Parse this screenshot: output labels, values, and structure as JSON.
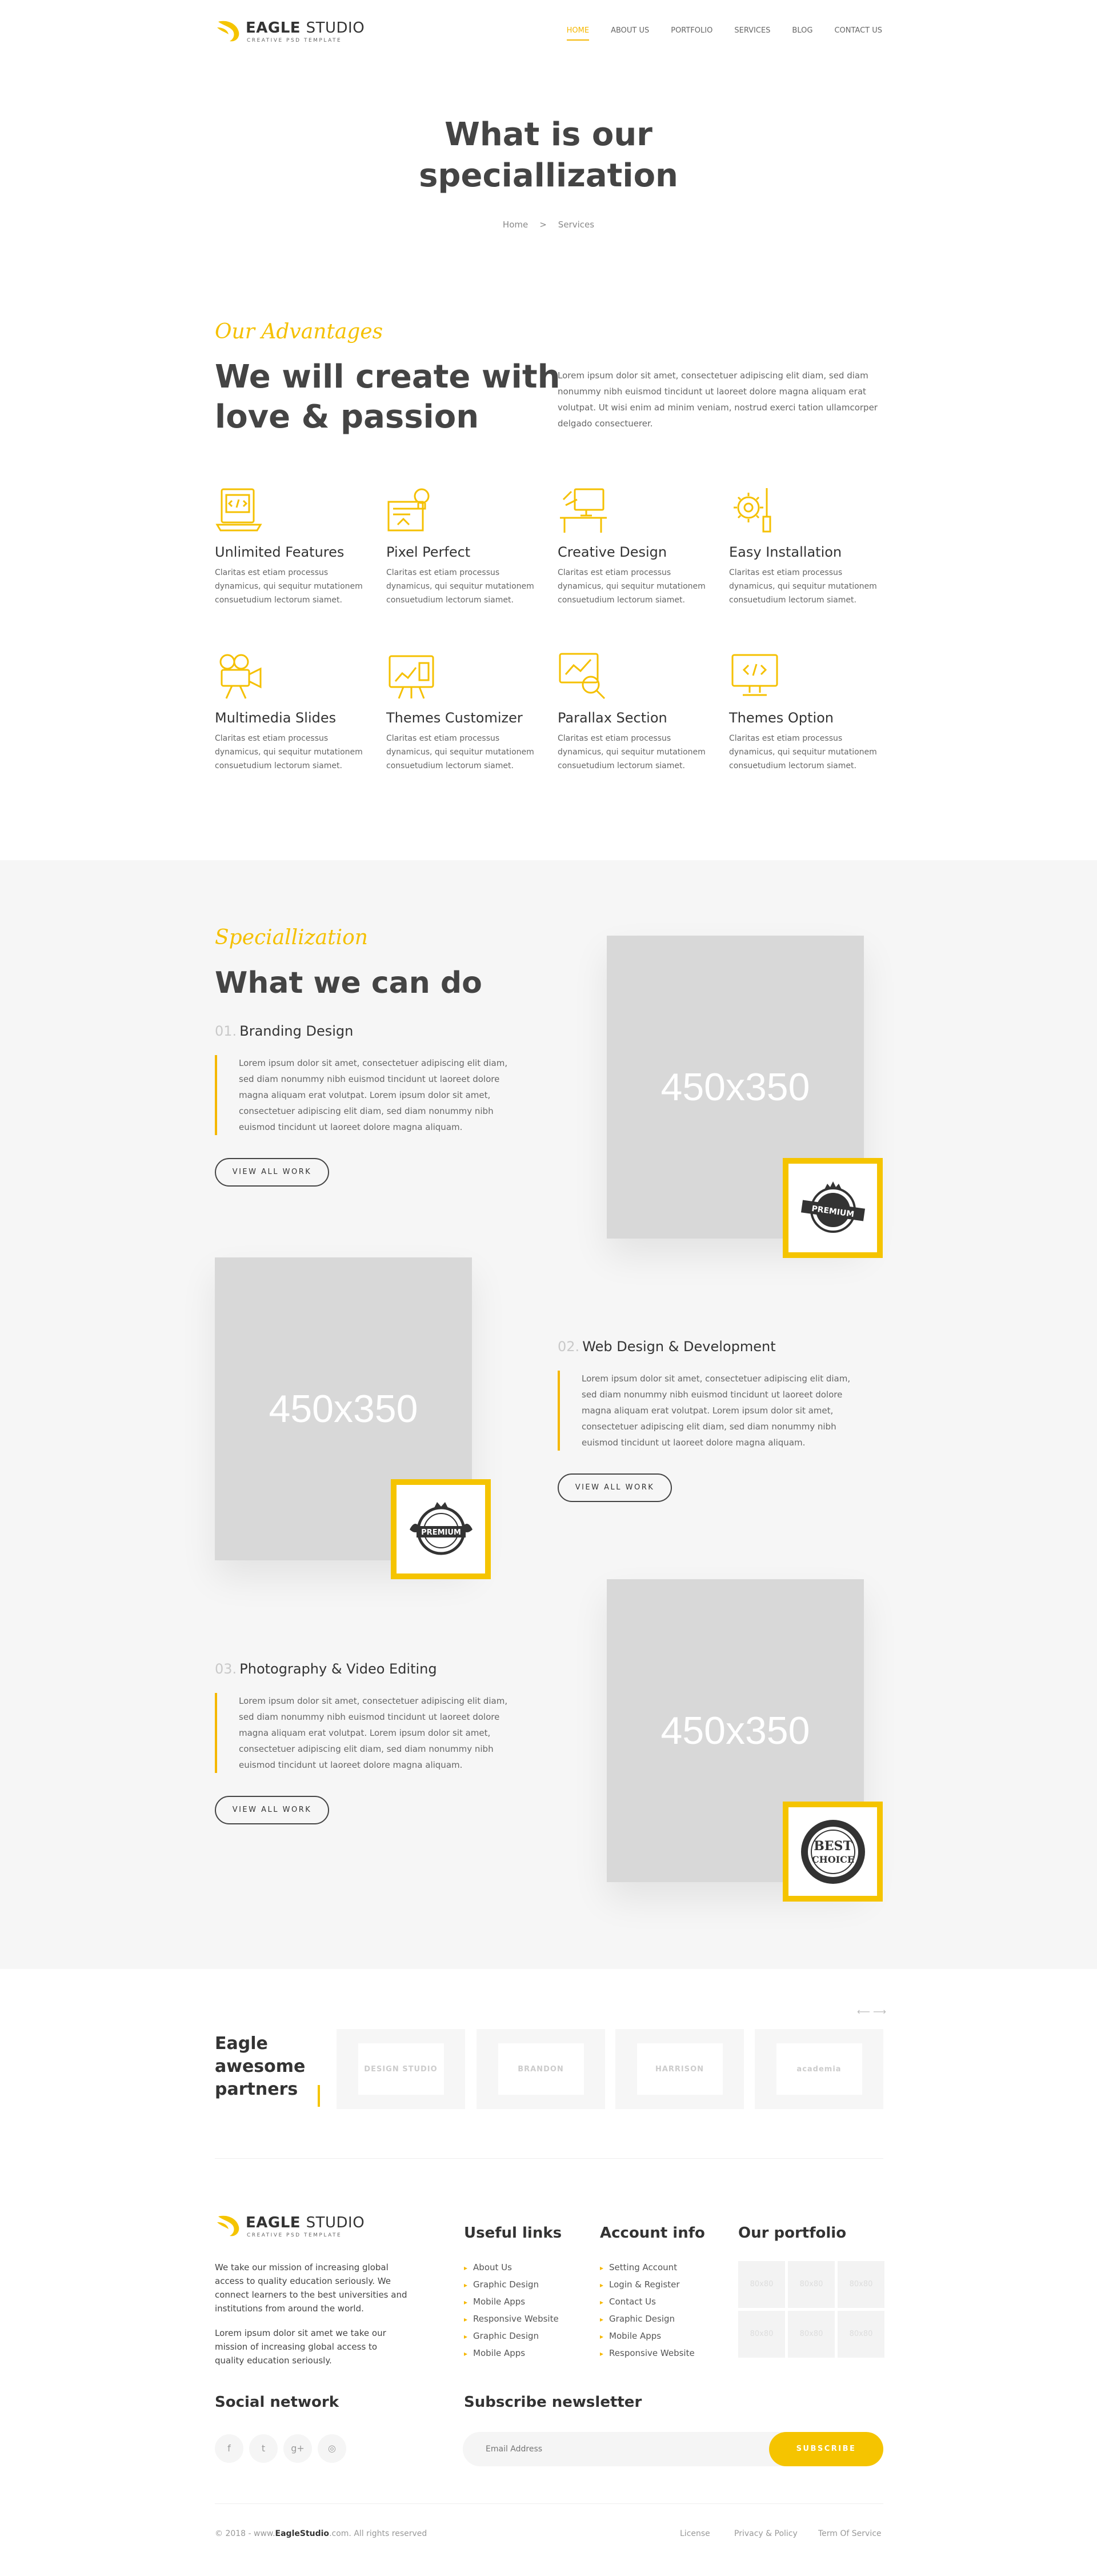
{
  "brand": {
    "name_bold": "EAGLE",
    "name_light": "STUDIO",
    "tagline": "CREATIVE PSD TEMPLATE"
  },
  "nav": [
    {
      "label": "HOME",
      "active": true
    },
    {
      "label": "ABOUT US",
      "active": false
    },
    {
      "label": "PORTFOLIO",
      "active": false
    },
    {
      "label": "SERVICES",
      "active": false
    },
    {
      "label": "BLOG",
      "active": false
    },
    {
      "label": "CONTACT US",
      "active": false
    }
  ],
  "hero": {
    "title_line1": "What is our",
    "title_line2": "speciallization",
    "breadcrumb": [
      "Home",
      ">",
      "Services"
    ]
  },
  "advantages": {
    "script": "Our Advantages",
    "title_line1": "We will create with",
    "title_line2": "love & passion",
    "intro": "Lorem ipsum dolor sit amet, consectetuer adipiscing elit diam, sed diam nonummy nibh euismod tincidunt ut laoreet dolore magna aliquam erat volutpat. Ut wisi enim ad minim veniam, nostrud exerci tation ullamcorper delgado consectuerer.",
    "features": [
      {
        "icon": "laptop-code-icon",
        "title": "Unlimited Features",
        "text": "Claritas est etiam processus dynamicus, qui sequitur mutationem consuetudium lectorum siamet."
      },
      {
        "icon": "design-tools-icon",
        "title": "Pixel Perfect",
        "text": "Claritas est etiam processus dynamicus, qui sequitur mutationem consuetudium lectorum siamet."
      },
      {
        "icon": "workspace-desk-icon",
        "title": "Creative Design",
        "text": "Claritas est etiam processus dynamicus, qui sequitur mutationem consuetudium lectorum siamet."
      },
      {
        "icon": "gear-wrench-icon",
        "title": "Easy Installation",
        "text": "Claritas est etiam processus dynamicus, qui sequitur mutationem consuetudium lectorum siamet."
      },
      {
        "icon": "video-camera-icon",
        "title": "Multimedia Slides",
        "text": "Claritas est etiam processus dynamicus, qui sequitur mutationem consuetudium lectorum siamet."
      },
      {
        "icon": "dashboard-board-icon",
        "title": "Themes Customizer",
        "text": "Claritas est etiam processus dynamicus, qui sequitur mutationem consuetudium lectorum siamet."
      },
      {
        "icon": "analytics-search-icon",
        "title": "Parallax Section",
        "text": "Claritas est etiam processus dynamicus, qui sequitur mutationem consuetudium lectorum siamet."
      },
      {
        "icon": "monitor-code-icon",
        "title": "Themes Option",
        "text": "Claritas est etiam processus dynamicus, qui sequitur mutationem consuetudium lectorum siamet."
      }
    ]
  },
  "specialization": {
    "script": "Speciallization",
    "title": "What we can do",
    "services": [
      {
        "num": "01.",
        "title": "Branding Design",
        "text": "Lorem ipsum dolor sit amet, consectetuer adipiscing elit diam, sed diam nonummy nibh euismod tincidunt ut laoreet dolore magna aliquam erat volutpat.  Lorem ipsum dolor sit amet, consectetuer adipiscing elit diam, sed diam nonummy nibh euismod tincidunt ut laoreet dolore magna aliquam.",
        "button": "VIEW ALL WORK",
        "placeholder": "450x350",
        "badge": "PREMIUM"
      },
      {
        "num": "02.",
        "title": "Web Design & Development",
        "text": "Lorem ipsum dolor sit amet, consectetuer adipiscing elit diam, sed diam nonummy nibh euismod tincidunt ut laoreet dolore magna aliquam erat volutpat.  Lorem ipsum dolor sit amet, consectetuer adipiscing elit diam, sed diam nonummy nibh euismod tincidunt ut laoreet dolore magna aliquam.",
        "button": "VIEW ALL WORK",
        "placeholder": "450x350",
        "badge": "PREMIUM"
      },
      {
        "num": "03.",
        "title": "Photography & Video Editing",
        "text": "Lorem ipsum dolor sit amet, consectetuer adipiscing elit diam, sed diam nonummy nibh euismod tincidunt ut laoreet dolore magna aliquam erat volutpat.  Lorem ipsum dolor sit amet, consectetuer adipiscing elit diam, sed diam nonummy nibh euismod tincidunt ut laoreet dolore magna aliquam.",
        "button": "VIEW ALL WORK",
        "placeholder": "450x350",
        "badge_line1": "BEST",
        "badge_line2": "CHOICE"
      }
    ]
  },
  "partners": {
    "title_line1": "Eagle",
    "title_line2": "awesome",
    "title_line3": "partners",
    "arrows": "⟵ ⟶",
    "logos": [
      "DESIGN STUDIO",
      "BRANDON",
      "HARRISON",
      "academia"
    ]
  },
  "footer": {
    "about1": "We take our mission of increasing global access to quality education seriously. We connect learners to the best universities and institutions from around the world.",
    "about2": "Lorem ipsum dolor sit amet we take our mission of increasing global access to quality education seriously.",
    "useful_links_title": "Useful links",
    "useful_links": [
      "About Us",
      "Graphic Design",
      "Mobile Apps",
      "Responsive Website",
      "Graphic Design",
      "Mobile Apps"
    ],
    "account_title": "Account info",
    "account_links": [
      "Setting Account",
      "Login & Register",
      "Contact Us",
      "Graphic Design",
      "Mobile Apps",
      "Responsive Website"
    ],
    "portfolio_title": "Our portfolio",
    "portfolio_thumb": "80x80",
    "social_title": "Social network",
    "social": [
      "f",
      "t",
      "g+",
      "◎"
    ],
    "newsletter_title": "Subscribe newsletter",
    "email_placeholder": "Email Address",
    "subscribe": "SUBSCRIBE",
    "copyright_pre": "© 2018 - www.",
    "copyright_site": "EagleStudio",
    "copyright_post": ".com. All rights reserved",
    "legal": [
      "License",
      "Privacy & Policy",
      "Term Of Service"
    ]
  },
  "colors": {
    "accent": "#f5c400",
    "dark_text": "#444444",
    "grey_bg": "#f6f6f6"
  }
}
